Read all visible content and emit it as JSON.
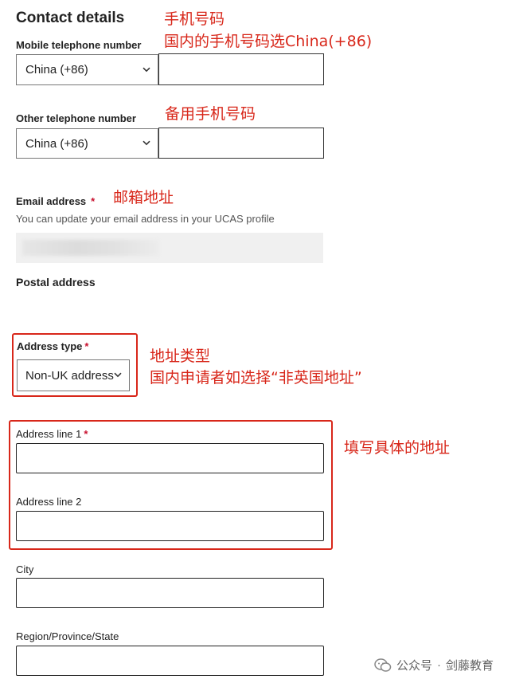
{
  "section_title": "Contact details",
  "mobile": {
    "label": "Mobile telephone number",
    "country_value": "China (+86)",
    "annotation_line1": "手机号码",
    "annotation_line2": "国内的手机号码选China(+86)"
  },
  "other": {
    "label": "Other telephone number",
    "country_value": "China (+86)",
    "annotation": "备用手机号码"
  },
  "email": {
    "label": "Email address",
    "required_mark": "*",
    "hint": "You can update your email address in your UCAS profile",
    "annotation": "邮箱地址"
  },
  "postal": {
    "title": "Postal address"
  },
  "address_type": {
    "label": "Address type",
    "required_mark": "*",
    "value": "Non-UK address",
    "annotation_line1": "地址类型",
    "annotation_line2": "国内申请者如选择“非英国地址”"
  },
  "address_line1": {
    "label": "Address line 1",
    "required_mark": "*"
  },
  "address_line2": {
    "label": "Address line 2"
  },
  "address_annotation": "填写具体的地址",
  "city": {
    "label": "City"
  },
  "region": {
    "label": "Region/Province/State"
  },
  "watermark": {
    "prefix": "公众号",
    "separator": "·",
    "name": "剑藤教育"
  },
  "colors": {
    "annotation_red": "#d8271a",
    "required_red": "#c8102e"
  }
}
